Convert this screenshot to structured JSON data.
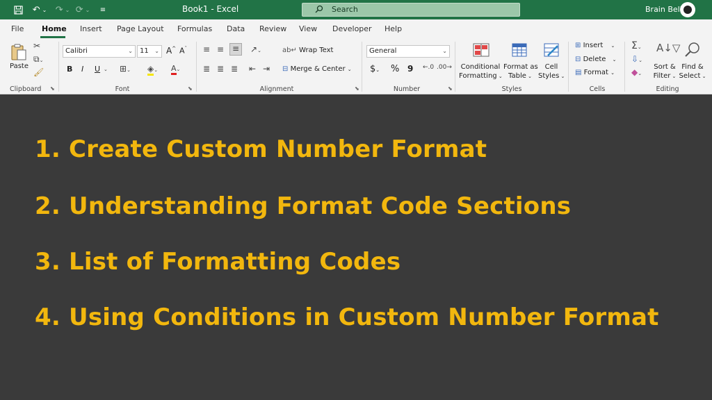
{
  "titlebar": {
    "title": "Book1 - Excel",
    "search_placeholder": "Search",
    "user_name": "Brain Bell"
  },
  "tabs": [
    "File",
    "Home",
    "Insert",
    "Page Layout",
    "Formulas",
    "Data",
    "Review",
    "View",
    "Developer",
    "Help"
  ],
  "active_tab": "Home",
  "ribbon": {
    "clipboard": {
      "paste": "Paste",
      "label": "Clipboard"
    },
    "font": {
      "family": "Calibri",
      "size": "11",
      "bold": "B",
      "italic": "I",
      "underline": "U",
      "label": "Font"
    },
    "alignment": {
      "wrap_text": "Wrap Text",
      "merge_center": "Merge & Center",
      "label": "Alignment"
    },
    "number": {
      "format": "General",
      "currency": "$",
      "percent": "%",
      "comma": "9",
      "label": "Number"
    },
    "styles": {
      "conditional_1": "Conditional",
      "conditional_2": "Formatting",
      "format_table_1": "Format as",
      "format_table_2": "Table",
      "cell_styles_1": "Cell",
      "cell_styles_2": "Styles",
      "label": "Styles"
    },
    "cells": {
      "insert": "Insert",
      "delete": "Delete",
      "format": "Format",
      "label": "Cells"
    },
    "editing": {
      "sort_1": "Sort &",
      "sort_2": "Filter",
      "find_1": "Find &",
      "find_2": "Select",
      "label": "Editing"
    }
  },
  "content": {
    "items": [
      "1. Create Custom Number Format",
      "2. Understanding Format Code Sections",
      "3. List of Formatting Codes",
      "4. Using Conditions in Custom Number Format"
    ]
  },
  "colors": {
    "titlebar": "#217346",
    "ribbon": "#f3f3f3",
    "content_bg": "#3a3a3a",
    "accent_text": "#f2b70e"
  }
}
